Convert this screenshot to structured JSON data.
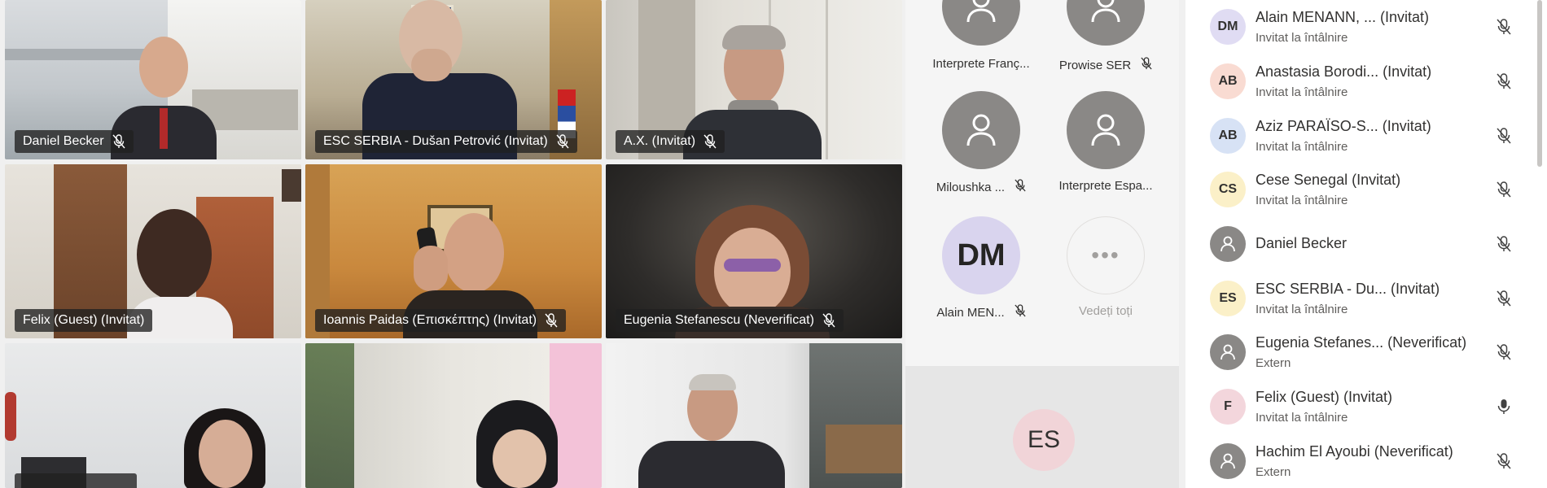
{
  "video_tiles": [
    {
      "name": "Daniel Becker",
      "muted": true
    },
    {
      "name": "ESC SERBIA - Dušan Petrović (Invitat)",
      "muted": true
    },
    {
      "name": "A.X. (Invitat)",
      "muted": true
    },
    {
      "name": "Felix (Guest) (Invitat)",
      "muted": false
    },
    {
      "name": "Ioannis Paidas (Επισκέπτης) (Invitat)",
      "muted": true
    },
    {
      "name": "Eugenia Stefanescu (Neverificat)",
      "muted": true
    },
    {
      "name": "",
      "muted": true
    },
    {
      "name": "",
      "muted": false
    },
    {
      "name": "",
      "muted": true
    }
  ],
  "roster": {
    "items": [
      {
        "name": "Interprete Franç...",
        "muted": false
      },
      {
        "name": "Prowise SER",
        "muted": true
      },
      {
        "name": "Miloushka ...",
        "muted": true
      },
      {
        "name": "Interprete Espa...",
        "muted": false
      },
      {
        "name": "Alain MEN...",
        "initials": "DM",
        "muted": true
      }
    ],
    "see_all_label": "Vedeți toți",
    "focused_initials": "ES"
  },
  "participants": [
    {
      "initials": "DM",
      "avatar_color": "#e0dcf3",
      "name": "Alain MENANN, ... (Invitat)",
      "status": "Invitat la întâlnire",
      "mic": "off"
    },
    {
      "initials": "AB",
      "avatar_color": "#f9dbd2",
      "name": "Anastasia Borodi... (Invitat)",
      "status": "Invitat la întâlnire",
      "mic": "off"
    },
    {
      "initials": "AB",
      "avatar_color": "#d7e2f5",
      "name": "Aziz PARAÏSO-S... (Invitat)",
      "status": "Invitat la întâlnire",
      "mic": "off"
    },
    {
      "initials": "CS",
      "avatar_color": "#fbf0c8",
      "name": "Cese Senegal (Invitat)",
      "status": "Invitat la întâlnire",
      "mic": "off"
    },
    {
      "initials": "",
      "avatar_color": "#8a8886",
      "name": "Daniel Becker",
      "status": "",
      "mic": "off"
    },
    {
      "initials": "ES",
      "avatar_color": "#fbf0c8",
      "name": "ESC SERBIA - Du... (Invitat)",
      "status": "Invitat la întâlnire",
      "mic": "off"
    },
    {
      "initials": "",
      "avatar_color": "#8a8886",
      "name": "Eugenia Stefanes... (Neverificat)",
      "status": "Extern",
      "mic": "off"
    },
    {
      "initials": "F",
      "avatar_color": "#f3d6dc",
      "name": "Felix (Guest) (Invitat)",
      "status": "Invitat la întâlnire",
      "mic": "on"
    },
    {
      "initials": "",
      "avatar_color": "#8a8886",
      "name": "Hachim El Ayoubi (Neverificat)",
      "status": "Extern",
      "mic": "off"
    }
  ]
}
